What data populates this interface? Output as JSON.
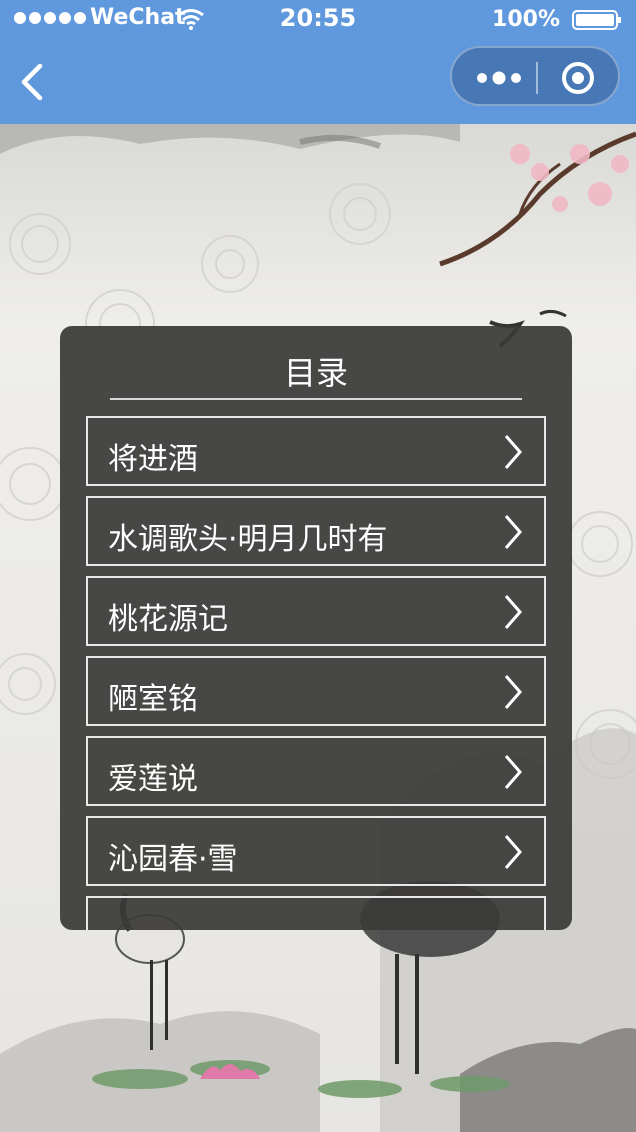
{
  "status_bar": {
    "carrier": "WeChat",
    "time": "20:55",
    "battery": "100%",
    "icons": [
      "signal-dots-icon",
      "wifi-icon",
      "battery-icon"
    ]
  },
  "nav": {
    "icons": [
      "back-chevron-icon",
      "more-dots-icon",
      "close-circle-icon"
    ]
  },
  "menu": {
    "title": "目录",
    "items": [
      {
        "label": "将进酒"
      },
      {
        "label": "水调歌头·明月几时有"
      },
      {
        "label": "桃花源记"
      },
      {
        "label": "陋室铭"
      },
      {
        "label": "爱莲说"
      },
      {
        "label": "沁园春·雪"
      }
    ],
    "item_icon": "chevron-right-icon"
  },
  "colors": {
    "nav_bar": "#5f98dc",
    "panel": "#3a3a38",
    "text": "#ffffff",
    "page_bg": "#ecebe7"
  }
}
